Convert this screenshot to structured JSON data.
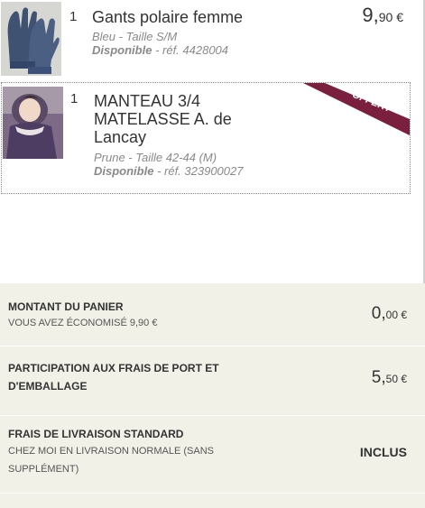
{
  "cart": {
    "items": [
      {
        "qty": "1",
        "name": "Gants polaire femme",
        "variant": "Bleu - Taille S/M",
        "availability": "Disponible",
        "ref": " - réf. 4428004",
        "price_int": "9,",
        "price_dec": "90 €",
        "image_icon": "gloves-image"
      },
      {
        "qty": "1",
        "name": "MANTEAU 3/4 MATELASSE A. de Lancay",
        "variant": "Prune - Taille 42-44 (M)",
        "availability": "Disponible",
        "ref": " - réf. 323900027",
        "badge": "OFFERT",
        "badge_color": "#7b1f3f",
        "image_icon": "coat-image"
      }
    ]
  },
  "summary": {
    "basket_total": {
      "title": "MONTANT DU PANIER",
      "savings": "VOUS AVEZ ÉCONOMISÉ 9,90 €",
      "amount_int": "0,",
      "amount_dec": "00 €"
    },
    "shipping_participation": {
      "title": "PARTICIPATION AUX FRAIS DE PORT ET D'EMBALLAGE",
      "amount_int": "5,",
      "amount_dec": "50 €"
    },
    "standard_delivery": {
      "title": "FRAIS DE LIVRAISON STANDARD",
      "description": "CHEZ MOI EN LIVRAISON NORMALE (SANS SUPPLÉMENT)",
      "status": "INCLUS"
    },
    "background": "#f2f1e8"
  }
}
